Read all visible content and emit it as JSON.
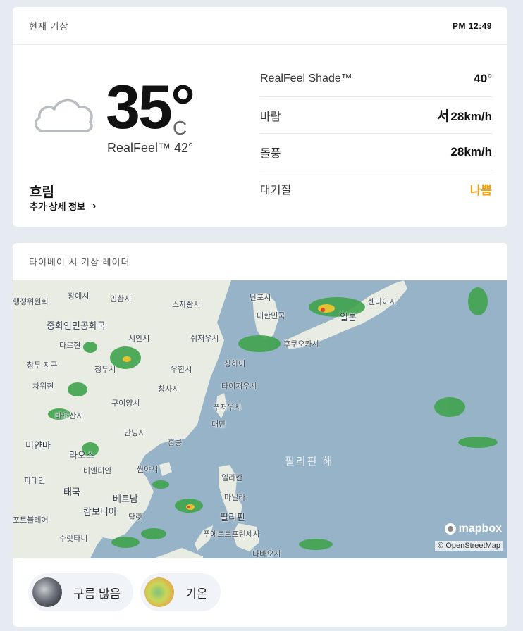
{
  "current": {
    "title": "현재 기상",
    "time": "PM 12:49",
    "icon": "cloud-icon",
    "temperature": "35°",
    "unit": "C",
    "realfeel": "RealFeel™ 42°",
    "condition": "흐림",
    "more_details": "추가 상세 정보",
    "details": [
      {
        "label": "RealFeel Shade™",
        "value": "40°"
      },
      {
        "label": "바람",
        "direction": "서",
        "value": "28km/h"
      },
      {
        "label": "돌풍",
        "value": "28km/h"
      },
      {
        "label": "대기질",
        "value": "나쁨",
        "status_color": "#f2a20c"
      }
    ]
  },
  "radar": {
    "title": "타이베이 시 기상 레이더",
    "sea_label": "필리핀 해",
    "attribution_logo": "mapbox",
    "attribution_text": "© OpenStreetMap",
    "places": [
      "장예시",
      "인촨시",
      "행정위원회",
      "스자좡시",
      "난포시",
      "대한민국",
      "일본",
      "센다이시",
      "중화인민공화국",
      "시안시",
      "쉬저우시",
      "후쿠오카시",
      "다르현",
      "창두 지구",
      "청두시",
      "우한시",
      "상하이",
      "차위현",
      "창사시",
      "타이저우시",
      "구이양시",
      "푸저우시",
      "바오산시",
      "대만",
      "난닝시",
      "미얀마",
      "라오스",
      "홍콩",
      "비엔티안",
      "싼야시",
      "파테인",
      "태국",
      "일라칸",
      "베트남",
      "마닐라",
      "캄보디아",
      "포트블레어",
      "달랏",
      "필리핀",
      "수랏타니",
      "푸에르토프린세사",
      "다바오시"
    ],
    "layers": [
      {
        "label": "구름 많음",
        "icon": "satellite-cloud-thumbnail"
      },
      {
        "label": "기온",
        "icon": "temperature-thumbnail"
      }
    ]
  }
}
